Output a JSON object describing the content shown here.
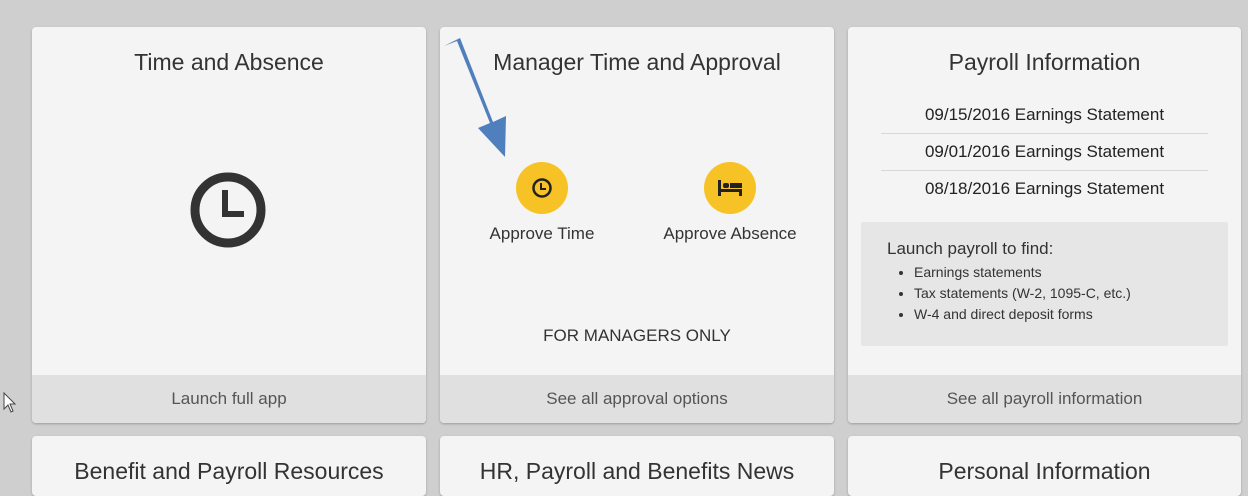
{
  "cards": {
    "time_absence": {
      "title": "Time and Absence",
      "icon": "clock-icon",
      "footer": "Launch full app"
    },
    "manager": {
      "title": "Manager Time and Approval",
      "actions": [
        {
          "label": "Approve Time",
          "icon": "clock-icon"
        },
        {
          "label": "Approve Absence",
          "icon": "bed-icon"
        }
      ],
      "note": "FOR MANAGERS ONLY",
      "footer": "See all approval options"
    },
    "payroll": {
      "title": "Payroll Information",
      "statements": [
        "09/15/2016 Earnings Statement",
        "09/01/2016 Earnings Statement",
        "08/18/2016 Earnings Statement"
      ],
      "info_intro": "Launch payroll to find:",
      "info_items": [
        "Earnings statements",
        "Tax statements (W-2, 1095-C, etc.)",
        "W-4 and direct deposit forms"
      ],
      "footer": "See all payroll information"
    }
  },
  "bottom_cards": [
    "Benefit and Payroll Resources",
    "HR, Payroll and Benefits News",
    "Personal Information"
  ],
  "colors": {
    "background": "#cfcfcf",
    "card": "#f4f4f4",
    "footer": "#e0e0e0",
    "accent": "#f6c226",
    "arrow": "#4f7fbd"
  }
}
